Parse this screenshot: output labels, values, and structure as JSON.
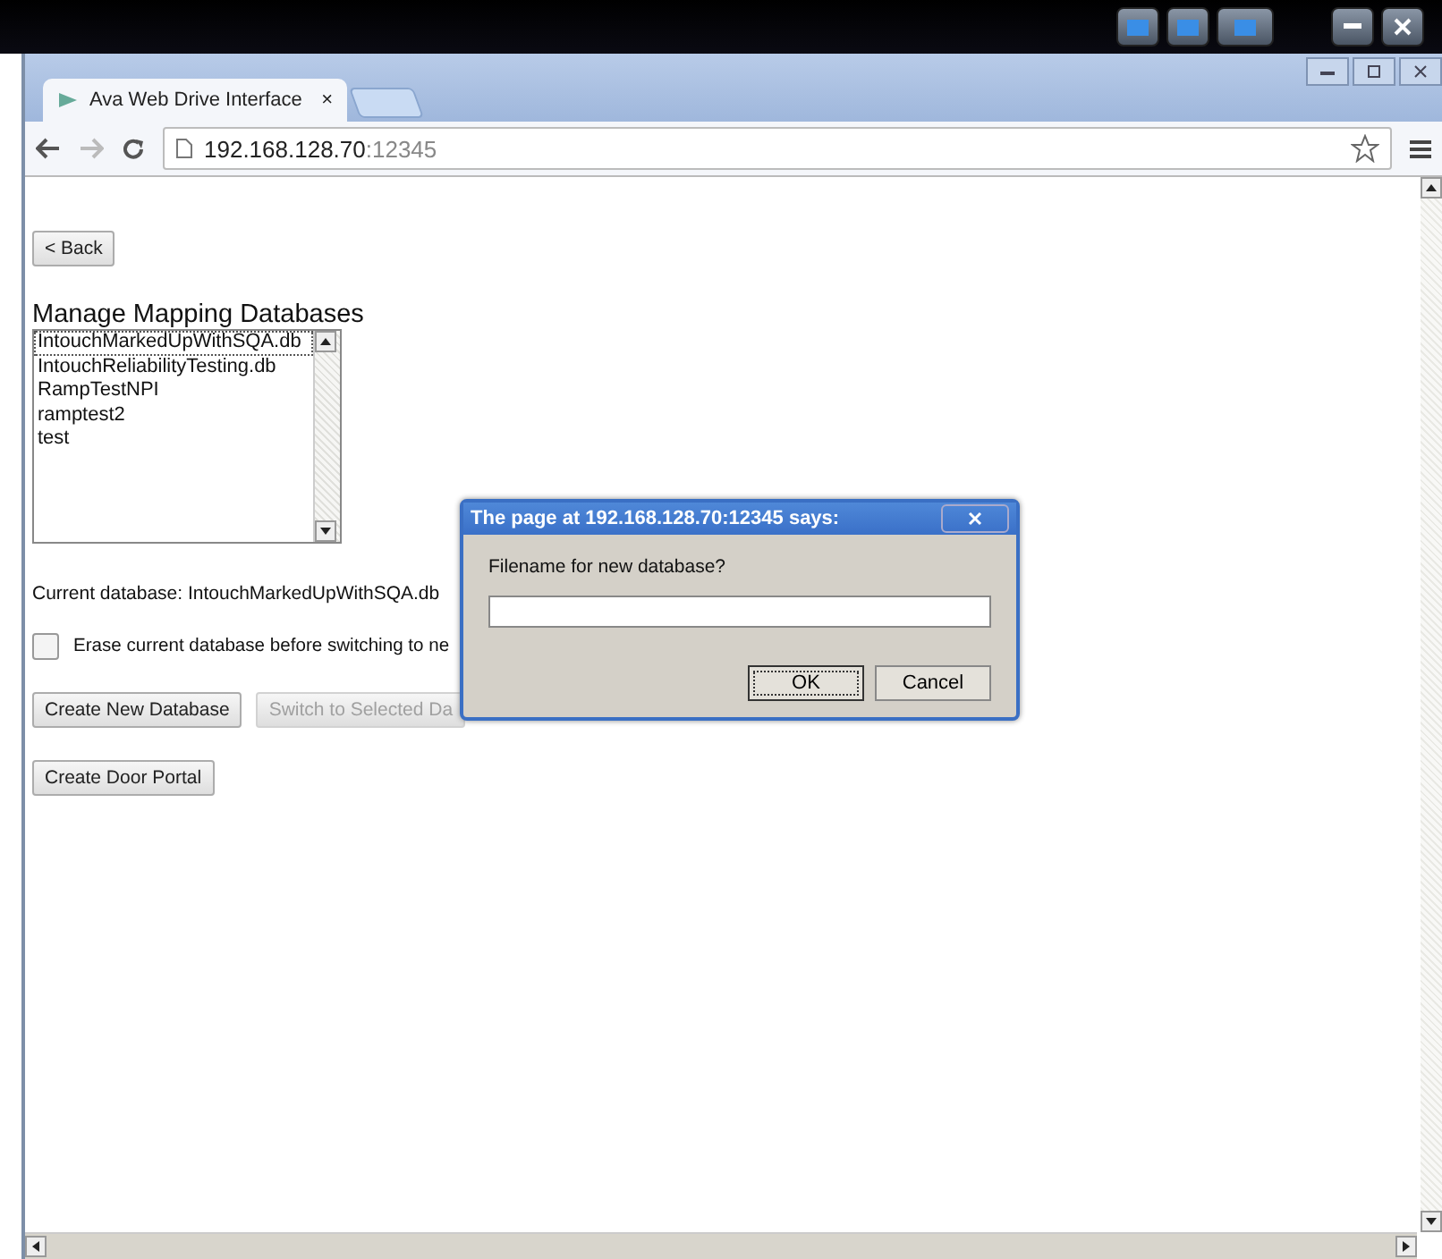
{
  "browser": {
    "tab": {
      "title": "Ava Web Drive Interface",
      "close": "×"
    },
    "url_host": "192.168.128.70",
    "url_port": ":12345"
  },
  "page": {
    "back_button": "< Back",
    "heading": "Manage Mapping Databases",
    "databases": [
      {
        "name": "IntouchMarkedUpWithSQA.db",
        "selected": true
      },
      {
        "name": "IntouchReliabilityTesting.db",
        "selected": false
      },
      {
        "name": "RampTestNPI",
        "selected": false
      },
      {
        "name": "ramptest2",
        "selected": false
      },
      {
        "name": "test",
        "selected": false
      }
    ],
    "current_database": "Current database: IntouchMarkedUpWithSQA.db",
    "erase_option": {
      "label": "Erase current database before switching to ne",
      "checked": false
    },
    "buttons": [
      {
        "label": "Create New Database",
        "disabled": false
      },
      {
        "label": "Switch to Selected Da",
        "disabled": true
      }
    ],
    "door_portal_button": "Create Door Portal"
  },
  "dialog": {
    "title": "The page at 192.168.128.70:12345 says:",
    "prompt": "Filename for new database?",
    "buttons": [
      {
        "label": "OK",
        "default": true
      },
      {
        "label": "Cancel",
        "default": false
      }
    ]
  }
}
